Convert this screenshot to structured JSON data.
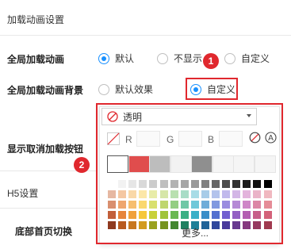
{
  "settings": {
    "section_loading": "加载动画设置",
    "global_anim_label": "全局加载动画",
    "anim_options": [
      "默认",
      "不显示",
      "自定义"
    ],
    "global_bg_label": "全局加载动画背景",
    "bg_options": [
      "默认效果",
      "自定义"
    ],
    "cancel_btn_label": "显示取消加载按钮",
    "section_h5": "H5设置",
    "bottom_home_label": "底部首页切换"
  },
  "badges": {
    "one": "1",
    "two": "2"
  },
  "color_picker": {
    "selected": "透明",
    "r_label": "R",
    "g_label": "G",
    "b_label": "B",
    "more_label": "更多...",
    "preset_swatches": [
      "#ffffff",
      "#e04d4d",
      "#bdbdbd",
      "#f2f2f2",
      "#8f8f8f",
      "#f5f5f5",
      "#f5f5f5",
      "#f5f5f5"
    ],
    "palette_row1": [
      "#ffffff",
      "#f2f2f2",
      "#e6e6e6",
      "#d9d9d9",
      "#cccccc",
      "#bfbfbf",
      "#b3b3b3",
      "#a6a6a6",
      "#999999",
      "#808080",
      "#666666",
      "#4d4d4d",
      "#333333",
      "#1a1a1a",
      "#111111",
      "#000000"
    ],
    "palette_rows": [
      [
        "#e6b8a2",
        "#f4c7a2",
        "#f9d8a8",
        "#fce7a8",
        "#e8eca8",
        "#d6e6a8",
        "#b9e0b0",
        "#a8dcc6",
        "#a8dce6",
        "#a8cce8",
        "#b3c3ec",
        "#c1b9ec",
        "#d3b6e6",
        "#e3b3dc",
        "#eab3c8",
        "#f0b8c0"
      ],
      [
        "#d98f6f",
        "#eea66f",
        "#f6be6f",
        "#fad86f",
        "#d9e06f",
        "#bfd66f",
        "#94ce82",
        "#6fc8a6",
        "#6fc8d9",
        "#6fadd9",
        "#8199e0",
        "#9a8ce0",
        "#b68ad6",
        "#cf86c8",
        "#dc86a6",
        "#e58c98"
      ],
      [
        "#c25f3a",
        "#e6843a",
        "#f0a13a",
        "#f6c73a",
        "#c8d13a",
        "#a0c43a",
        "#6ab852",
        "#3ab084",
        "#3ab0c8",
        "#3a8ec8",
        "#5470d0",
        "#7260d0",
        "#9460c4",
        "#b35eb2",
        "#c75e8a",
        "#d3627a"
      ],
      [
        "#8f3a1f",
        "#b85a1f",
        "#c7771f",
        "#d29b1f",
        "#9aa11f",
        "#76931f",
        "#43872f",
        "#1f8060",
        "#1f8098",
        "#1f6398",
        "#30479c",
        "#4a3a9c",
        "#683a90",
        "#85387f",
        "#963860",
        "#a03a50"
      ]
    ]
  }
}
